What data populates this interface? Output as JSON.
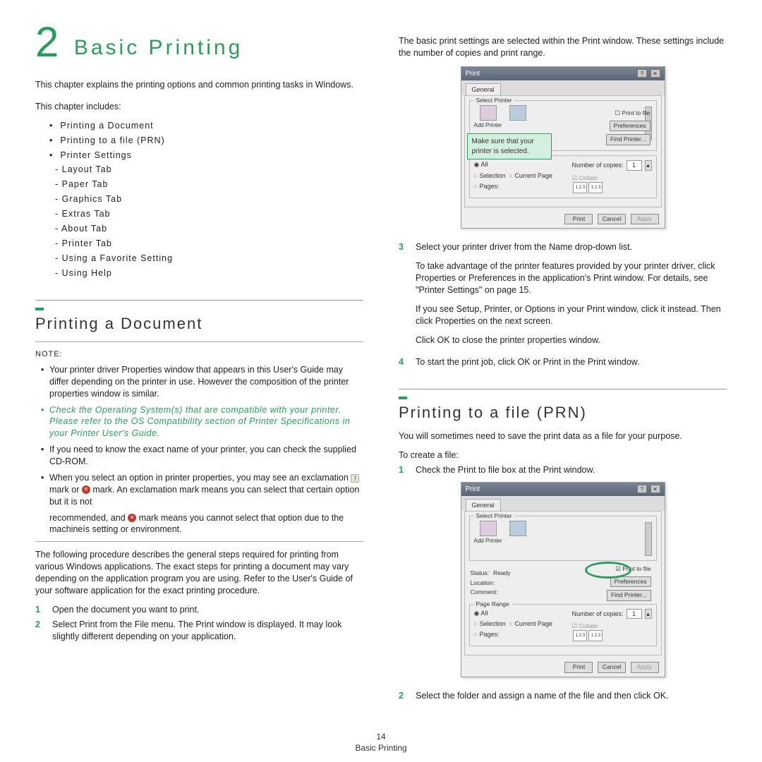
{
  "chapter": {
    "number": "2",
    "title": "Basic Printing"
  },
  "intro": "This chapter explains the printing options and common printing tasks in Windows.",
  "includes_label": "This chapter includes:",
  "toc": {
    "items": [
      "Printing a Document",
      "Printing to a file (PRN)",
      "Printer Settings"
    ],
    "sub": [
      "Layout Tab",
      "Paper Tab",
      "Graphics Tab",
      "Extras Tab",
      "About Tab",
      "Printer Tab",
      "Using a Favorite Setting",
      "Using Help"
    ]
  },
  "section1": {
    "title": "Printing a Document",
    "note_label": "NOTE:",
    "bullets": [
      "Your printer driver Properties window that appears in this User's Guide may differ depending on the printer in use. However the composition of the printer properties window is similar.",
      "Check the Operating System(s) that are compatible with your printer. Please refer to the OS Compatibility section of Printer Specifications in your Printer User's Guide.",
      "If you need to know the exact name of your printer, you can check the supplied CD-ROM.",
      "When you select an option in printer properties, you may see an exclamation   mark or   mark. An exclamation mark means you can select that certain option but it is not recommended, and   mark means you cannot select that option due to the machineís setting or environment."
    ],
    "procedure_intro": "The following procedure describes the general steps required for printing from various Windows applications. The exact steps for printing a document may vary depending on the application program you are using. Refer to the User's Guide of your software application for the exact printing procedure.",
    "steps": [
      "Open the document you want to print.",
      "Select Print from the File menu. The Print window is displayed. It may look slightly different depending on your application."
    ]
  },
  "right_intro": "The basic print settings are selected within the Print window. These settings include the number of copies and print range.",
  "dialog1": {
    "title": "Print",
    "tab": "General",
    "group_select": "Select Printer",
    "add_printer": "Add Printer",
    "print_to_file": "Print to file",
    "preferences": "Preferences",
    "find_printer": "Find Printer...",
    "callout": "Make sure that your printer is selected.",
    "all": "All",
    "selection": "Selection",
    "current_page": "Current Page",
    "pages": "Pages:",
    "copies_label": "Number of copies:",
    "copies_value": "1",
    "collate": "Collate",
    "btn_print": "Print",
    "btn_cancel": "Cancel",
    "btn_apply": "Apply"
  },
  "right_steps": {
    "s3a": "Select your printer driver from the Name drop-down list.",
    "s3b": "To take advantage of the printer features provided by your printer driver, click Properties or Preferences in the application's Print window. For details, see \"Printer Settings\" on page 15.",
    "s3c": "If you see Setup, Printer, or Options in your Print window, click it instead. Then click Properties on the next screen.",
    "s3d": "Click OK to close the printer properties window.",
    "s4": "To start the print job, click OK or Print in the Print window."
  },
  "section2": {
    "title": "Printing to a file (PRN)",
    "intro": "You will sometimes need to save the print data as a file for your purpose.",
    "create_label": "To create a file:",
    "step1": "Check the Print to file box at the Print window.",
    "step2": "Select the folder and assign a name of the file and then click OK."
  },
  "dialog2": {
    "title": "Print",
    "tab": "General",
    "group_select": "Select Printer",
    "add_printer": "Add Printer",
    "status_label": "Status:",
    "status_value": "Ready",
    "location_label": "Location:",
    "comment_label": "Comment:",
    "print_to_file": "Print to file",
    "preferences": "Preferences",
    "find_printer": "Find Printer...",
    "page_range": "Page Range",
    "all": "All",
    "selection": "Selection",
    "current_page": "Current Page",
    "pages": "Pages:",
    "copies_label": "Number of copies:",
    "copies_value": "1",
    "collate": "Collate",
    "btn_print": "Print",
    "btn_cancel": "Cancel",
    "btn_apply": "Apply"
  },
  "footer": {
    "page": "14",
    "title": "Basic Printing"
  }
}
